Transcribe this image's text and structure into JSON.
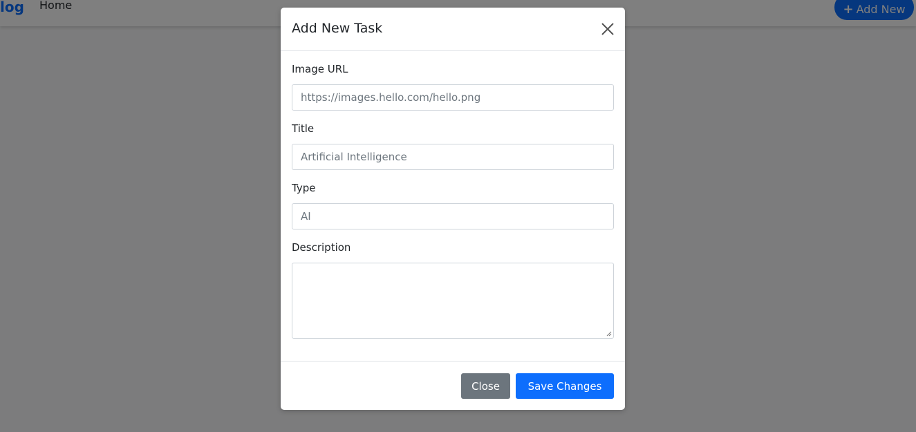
{
  "navbar": {
    "brand": "log",
    "home_link": "Home",
    "add_new_icon": "plus-icon",
    "add_new_label": "Add New"
  },
  "modal": {
    "title": "Add New Task",
    "close_icon": "close-icon",
    "fields": {
      "image_url": {
        "label": "Image URL",
        "placeholder": "https://images.hello.com/hello.png",
        "value": ""
      },
      "title": {
        "label": "Title",
        "placeholder": "Artificial Intelligence",
        "value": ""
      },
      "type": {
        "label": "Type",
        "placeholder": "AI",
        "value": ""
      },
      "description": {
        "label": "Description",
        "value": ""
      }
    },
    "buttons": {
      "close": "Close",
      "save": "Save Changes"
    }
  },
  "colors": {
    "primary": "#0d6efd",
    "secondary": "#6c757d",
    "backdrop": "rgba(0,0,0,0.5)"
  }
}
